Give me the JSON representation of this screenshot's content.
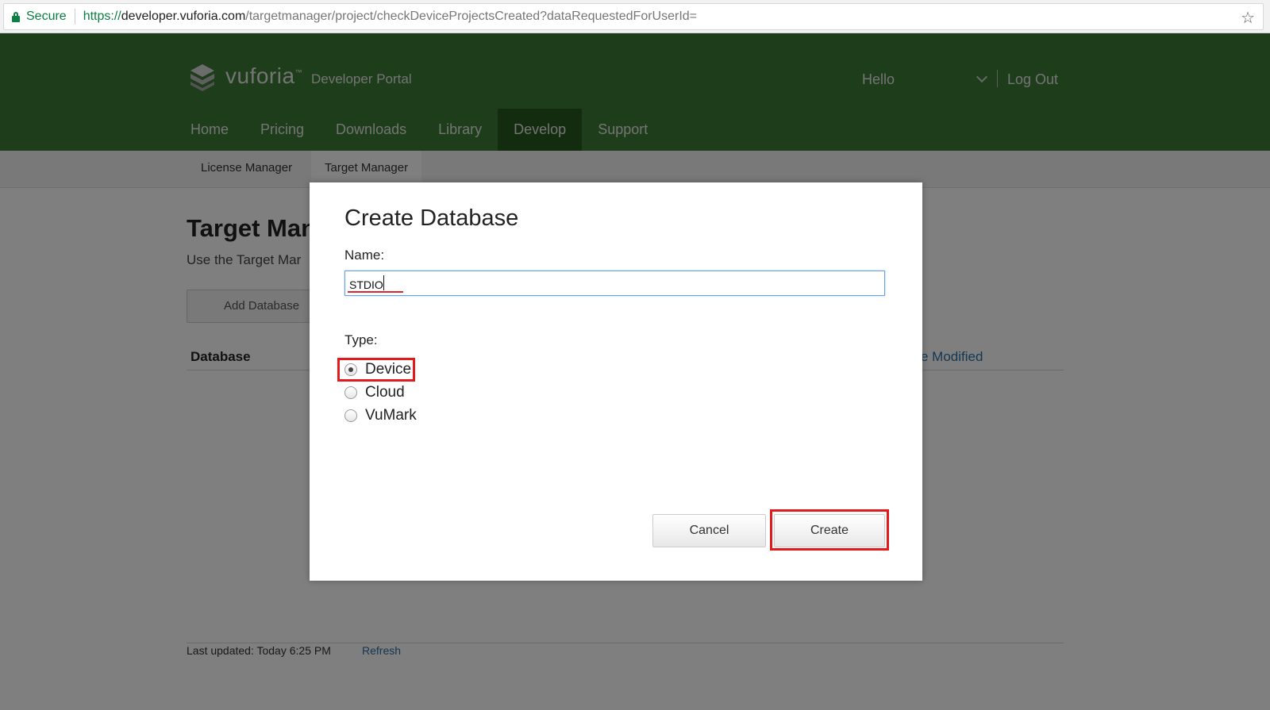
{
  "browser": {
    "secure_label": "Secure",
    "url_scheme": "https://",
    "url_host": "developer.vuforia.com",
    "url_path": "/targetmanager/project/checkDeviceProjectsCreated?dataRequestedForUserId="
  },
  "header": {
    "logo_text": "vuforia",
    "logo_tm": "™",
    "logo_sub": "Developer Portal",
    "hello": "Hello",
    "logout": "Log Out",
    "nav": [
      "Home",
      "Pricing",
      "Downloads",
      "Library",
      "Develop",
      "Support"
    ],
    "active_nav": "Develop"
  },
  "subnav": {
    "license_manager": "License Manager",
    "target_manager": "Target Manager"
  },
  "main": {
    "title": "Target Man",
    "description": "Use the Target Mar",
    "add_database": "Add Database",
    "col_database": "Database",
    "col_modified": "e Modified",
    "last_updated": "Last updated: Today 6:25 PM",
    "refresh": "Refresh"
  },
  "modal": {
    "title": "Create Database",
    "name_label": "Name:",
    "name_value": "STDIO",
    "type_label": "Type:",
    "types": [
      "Device",
      "Cloud",
      "VuMark"
    ],
    "selected_type": "Device",
    "cancel": "Cancel",
    "create": "Create"
  },
  "colors": {
    "header_green": "#3d7a34",
    "active_nav": "#27561f",
    "highlight_red": "#e31a1c",
    "link_blue": "#2a6ea5"
  },
  "icons": [
    "lock-icon",
    "bookmark-star-icon",
    "vuforia-logo-icon",
    "chevron-down-icon"
  ]
}
